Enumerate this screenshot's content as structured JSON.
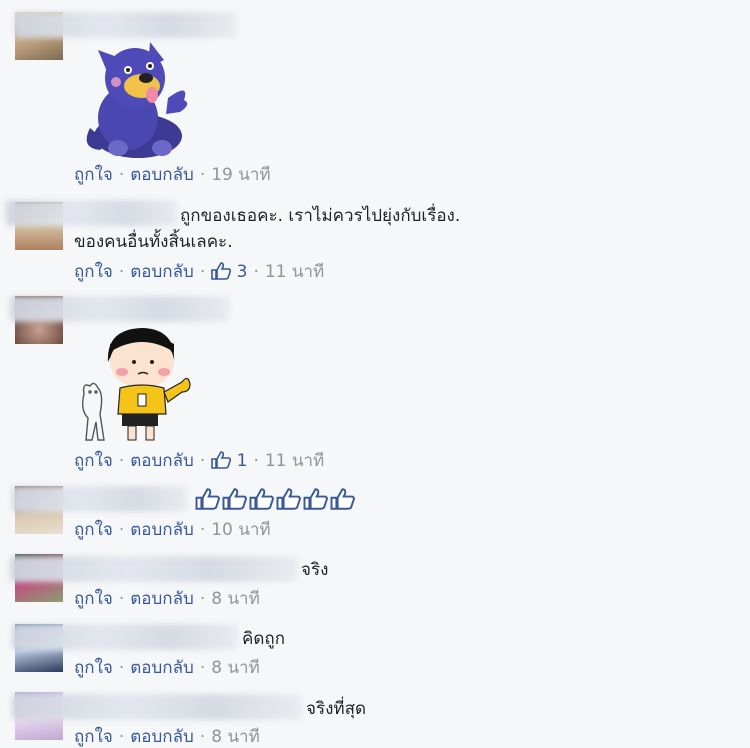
{
  "comments": [
    {
      "text": "",
      "sticker": "purple-dog-thumbs-up-sticker",
      "like_label": "ถูกใจ",
      "reply_label": "ตอบกลับ",
      "time": "19 นาที"
    },
    {
      "text_line1": "ถูกของเธอคะ. เราไม่ควรไปยุ่งกับเรื่อง.",
      "text_line2": "ของคนอื่นทั้งสิ้นเลคะ.",
      "like_label": "ถูกใจ",
      "reply_label": "ตอบกลับ",
      "likes": "3",
      "time": "11 นาที"
    },
    {
      "sticker": "girl-thumbs-up-sticker",
      "like_label": "ถูกใจ",
      "reply_label": "ตอบกลับ",
      "likes": "1",
      "time": "11 นาที"
    },
    {
      "emoji": "thumbs-up-x6",
      "like_label": "ถูกใจ",
      "reply_label": "ตอบกลับ",
      "time": "10 นาที"
    },
    {
      "text": "จริง",
      "like_label": "ถูกใจ",
      "reply_label": "ตอบกลับ",
      "time": "8 นาที"
    },
    {
      "text": "คิดถูก",
      "like_label": "ถูกใจ",
      "reply_label": "ตอบกลับ",
      "time": "8 นาที"
    },
    {
      "text": "จริงที่สุด",
      "like_label": "ถูกใจ",
      "reply_label": "ตอบกลับ",
      "time": "8 นาที"
    }
  ],
  "colors": {
    "background": "#f6f7f9",
    "link": "#365899",
    "meta": "#90949c",
    "text": "#1d2129"
  }
}
